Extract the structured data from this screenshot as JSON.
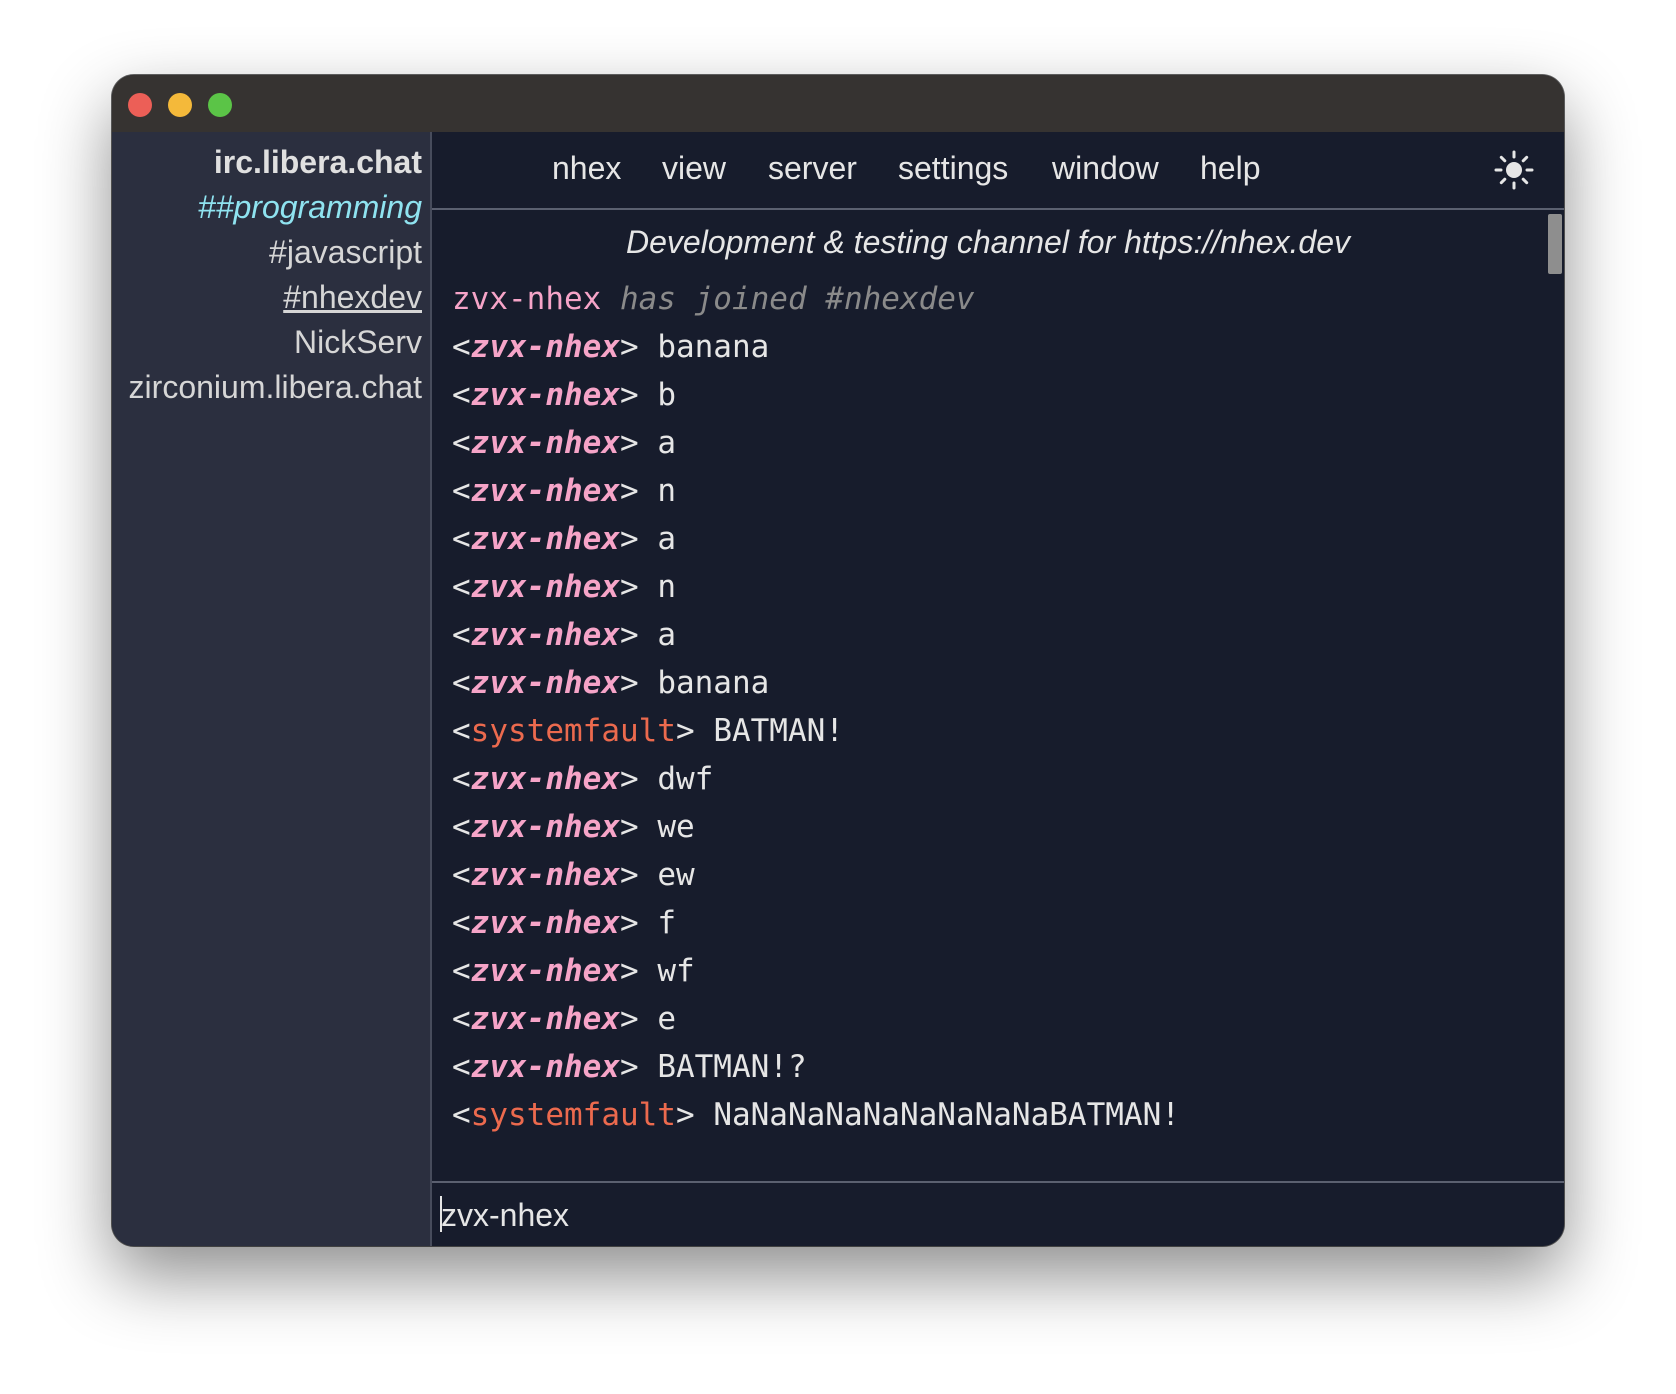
{
  "sidebar": {
    "items": [
      {
        "label": "irc.libera.chat"
      },
      {
        "label": "##programming"
      },
      {
        "label": "#javascript"
      },
      {
        "label": "#nhexdev"
      },
      {
        "label": "NickServ"
      },
      {
        "label": "zirconium.libera.chat"
      }
    ]
  },
  "menu": {
    "items": [
      {
        "label": "nhex"
      },
      {
        "label": "view"
      },
      {
        "label": "server"
      },
      {
        "label": "settings"
      },
      {
        "label": "window"
      },
      {
        "label": "help"
      }
    ],
    "theme_icon": "sun-icon"
  },
  "topic": "Development & testing channel for https://nhex.dev",
  "join": {
    "nick": "zvx-nhex",
    "text": "has joined #nhexdev"
  },
  "messages": [
    {
      "nick": "zvx-nhex",
      "text": "banana"
    },
    {
      "nick": "zvx-nhex",
      "text": "b"
    },
    {
      "nick": "zvx-nhex",
      "text": "a"
    },
    {
      "nick": "zvx-nhex",
      "text": "n"
    },
    {
      "nick": "zvx-nhex",
      "text": "a"
    },
    {
      "nick": "zvx-nhex",
      "text": "n"
    },
    {
      "nick": "zvx-nhex",
      "text": "a"
    },
    {
      "nick": "zvx-nhex",
      "text": "banana"
    },
    {
      "nick": "systemfault",
      "text": "BATMAN!"
    },
    {
      "nick": "zvx-nhex",
      "text": "dwf"
    },
    {
      "nick": "zvx-nhex",
      "text": "we"
    },
    {
      "nick": "zvx-nhex",
      "text": "ew"
    },
    {
      "nick": "zvx-nhex",
      "text": "f"
    },
    {
      "nick": "zvx-nhex",
      "text": "wf"
    },
    {
      "nick": "zvx-nhex",
      "text": "e"
    },
    {
      "nick": "zvx-nhex",
      "text": "BATMAN!?"
    },
    {
      "nick": "systemfault",
      "text": "NaNaNaNaNaNaNaNaNaBATMAN!"
    }
  ],
  "input": {
    "value": "zvx-nhex"
  },
  "colors": {
    "self_nick": "#f6a4c8",
    "other_nick": "#ec6a4e",
    "highlight_channel": "#8fe3f0",
    "background": "#171c2c",
    "sidebar_background": "#2b2f3f"
  }
}
